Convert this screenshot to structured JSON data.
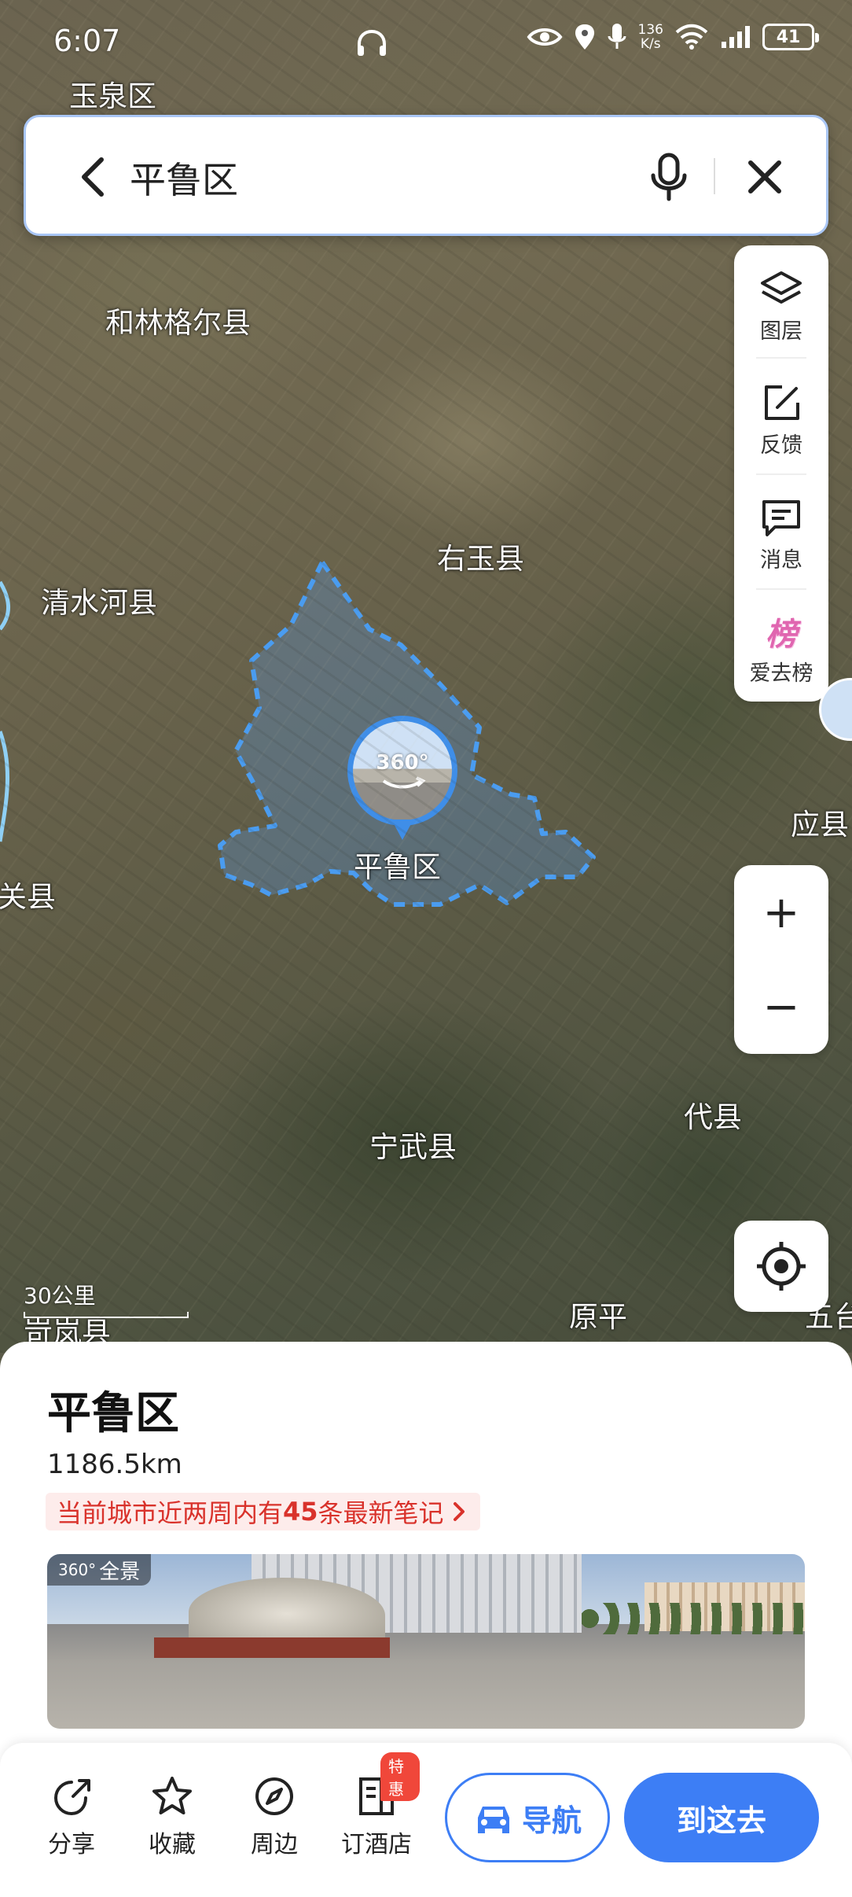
{
  "status_bar": {
    "time": "6:07",
    "net_speed_value": "136",
    "net_speed_unit": "K/s",
    "battery": "41"
  },
  "search": {
    "query": "平鲁区"
  },
  "map": {
    "places": [
      {
        "id": "yuquan",
        "name": "玉泉区"
      },
      {
        "id": "helingeer",
        "name": "和林格尔县"
      },
      {
        "id": "youyu",
        "name": "右玉县"
      },
      {
        "id": "qingshuihe",
        "name": "清水河县"
      },
      {
        "id": "pinglu",
        "name": "平鲁区"
      },
      {
        "id": "pianguan",
        "name": "偏关县"
      },
      {
        "id": "ying",
        "name": "应县"
      },
      {
        "id": "ningwu",
        "name": "宁武县"
      },
      {
        "id": "dai",
        "name": "代县"
      },
      {
        "id": "kelan",
        "name": "岢岚县"
      },
      {
        "id": "yuanping",
        "name": "原平"
      },
      {
        "id": "wutai",
        "name": "五台"
      }
    ],
    "pin_label": "360°",
    "scale_label": "30公里"
  },
  "tools": {
    "layers": "图层",
    "feedback": "反馈",
    "messages": "消息",
    "ranking_icon_text": "榜",
    "ranking": "爱去榜"
  },
  "zoom": {
    "in": "+",
    "out": "−"
  },
  "sheet": {
    "title": "平鲁区",
    "distance": "1186.5km",
    "notes_prefix": "当前城市近两周内有",
    "notes_count": "45",
    "notes_suffix": "条最新笔记",
    "pano_tag": "全景",
    "pano_tag_prefix": "360°"
  },
  "actions": {
    "share": "分享",
    "favorite": "收藏",
    "nearby": "周边",
    "hotel": "订酒店",
    "hotel_badge": "特惠",
    "navigate": "导航",
    "go_here": "到这去"
  },
  "colors": {
    "accent": "#3d7ef5",
    "notes_red": "#d9322b",
    "badge_red": "#f0473a",
    "region_outline": "#4a9cf0"
  }
}
